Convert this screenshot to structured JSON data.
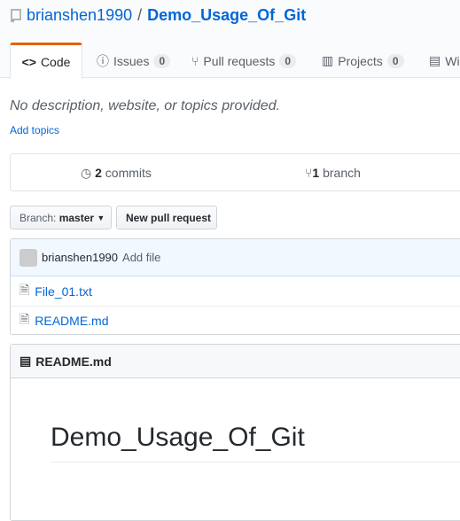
{
  "repo": {
    "owner": "brianshen1990",
    "separator": "/",
    "name": "Demo_Usage_Of_Git"
  },
  "tabs": [
    {
      "label": "Code"
    },
    {
      "label": "Issues",
      "count": "0"
    },
    {
      "label": "Pull requests",
      "count": "0"
    },
    {
      "label": "Projects",
      "count": "0"
    },
    {
      "label": "Wiki"
    }
  ],
  "description": "No description, website, or topics provided.",
  "add_topics": "Add topics",
  "summary": {
    "commits_num": "2",
    "commits_label": "commits",
    "branch_num": "1",
    "branch_label": "branch"
  },
  "branch_button": {
    "prefix": "Branch:",
    "value": "master"
  },
  "new_pr": "New pull request",
  "commit": {
    "author": "brianshen1990",
    "message": "Add file"
  },
  "files": [
    {
      "name": "File_01.txt"
    },
    {
      "name": "README.md"
    }
  ],
  "readme": {
    "header": "README.md",
    "heading": "Demo_Usage_Of_Git"
  }
}
